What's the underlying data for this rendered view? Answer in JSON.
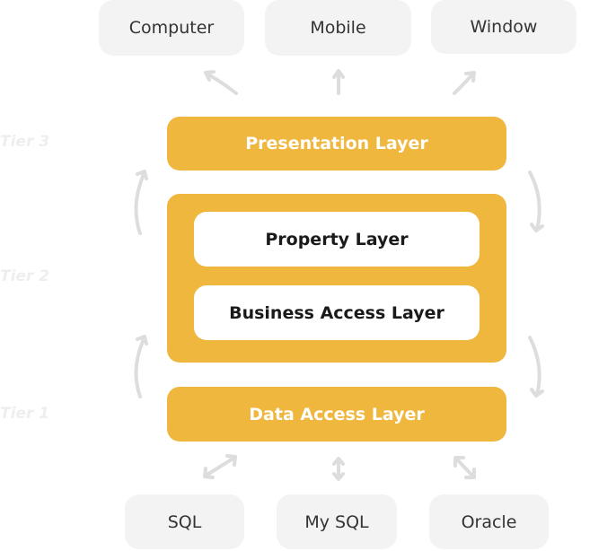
{
  "clients": {
    "computer": "Computer",
    "mobile": "Mobile",
    "window": "Window"
  },
  "tiers": {
    "tier3": "Tier 3",
    "tier2": "Tier 2",
    "tier1": "Tier 1"
  },
  "layers": {
    "presentation": "Presentation Layer",
    "property": "Property Layer",
    "business": "Business Access Layer",
    "data_access": "Data Access Layer"
  },
  "databases": {
    "sql": "SQL",
    "mysql": "My SQL",
    "oracle": "Oracle"
  },
  "colors": {
    "layer": "#efb73e",
    "client_bg": "#f3f3f3",
    "arrow": "#dddddd"
  }
}
